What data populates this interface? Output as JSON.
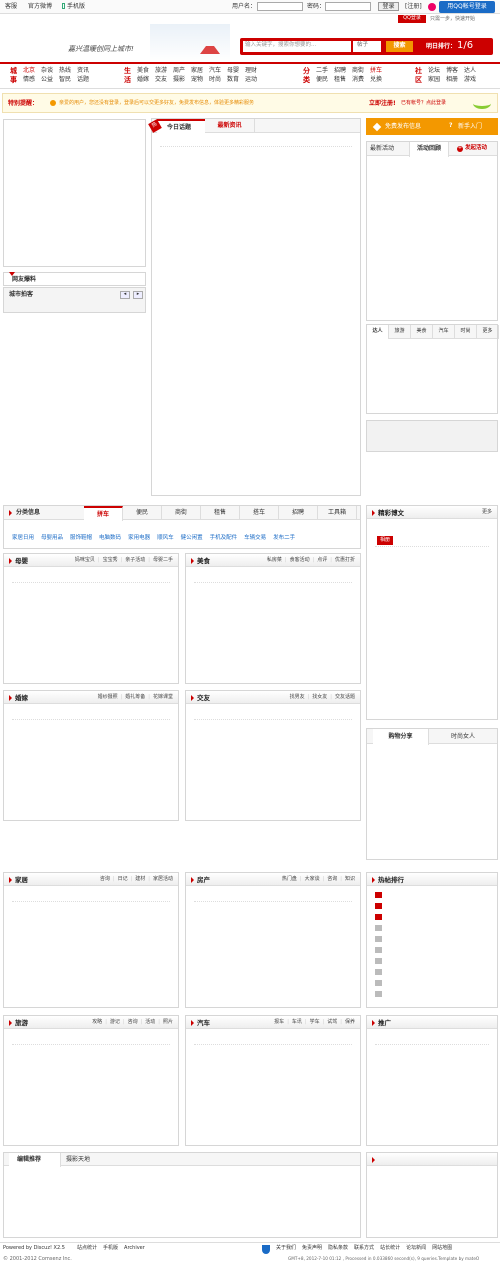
{
  "topbar": {
    "links": [
      "客服",
      "官方微博",
      "手机版"
    ],
    "username_label": "用户名：",
    "password_label": "密码：",
    "login_button": "登录",
    "register_link": "[注册]",
    "qq_login": "用QQ帐号登录",
    "qq_badge": "QQ登录",
    "qq_hint": "只需一步，快速开始"
  },
  "header": {
    "slogan": "嘉兴温暖创同上城市!",
    "search_placeholder": "输入关键字，搜索你想要的...",
    "search_type": "帖子",
    "search_button": "搜索",
    "countdown_label": "明日排行：",
    "countdown_value": "1/6"
  },
  "nav": {
    "groups": [
      {
        "title": [
          "城",
          "事"
        ],
        "rows": [
          [
            "北京",
            "杂谈",
            "热线",
            "资讯"
          ],
          [
            "情感",
            "公益",
            "智民",
            "话题"
          ]
        ],
        "red": [
          0
        ]
      },
      {
        "title": [
          "生",
          "活"
        ],
        "rows": [
          [
            "美食",
            "旅游",
            "周产",
            "家居",
            "汽车",
            "母婴",
            "理财"
          ],
          [
            "婚嫁",
            "交友",
            "摄影",
            "宠物",
            "时尚",
            "数育",
            "运动"
          ]
        ],
        "red": []
      },
      {
        "title": [
          "分",
          "类"
        ],
        "rows": [
          [
            "二手",
            "招聘",
            "商街",
            "拼车"
          ],
          [
            "便民",
            "租售",
            "消费",
            "兑换"
          ]
        ],
        "red": [
          3
        ]
      },
      {
        "title": [
          "社",
          "区"
        ],
        "rows": [
          [
            "论坛",
            "博客",
            "达人"
          ],
          [
            "家园",
            "相册",
            "游戏"
          ]
        ],
        "red": []
      }
    ]
  },
  "notice": {
    "label": "特别提醒：",
    "text": "亲爱的用户，您还没有登录，登录后可以交更多好友，免费发布信息，体验更多精彩服务",
    "sign": "立即注册!",
    "sign2": "已有帐号？点此登录"
  },
  "left": {
    "hot": "网友爆料",
    "city": "城市拍客"
  },
  "center": {
    "tabs": [
      "今日话题",
      "最新资讯"
    ],
    "badge": "热"
  },
  "right": {
    "publish": "免费发布信息",
    "newbie": "新手入门",
    "tabs": [
      "最新活动",
      "活动回顾",
      "发起活动"
    ],
    "people_tabs": [
      "达人",
      "旅游",
      "美食",
      "汽车",
      "时尚",
      "更多"
    ]
  },
  "classify": {
    "title": "分类信息",
    "tabs": [
      "拼车",
      "便民",
      "商街",
      "租售",
      "搭车",
      "招聘",
      "工具箱"
    ],
    "cats": [
      "家居日用",
      "母婴用品",
      "服饰鞋帽",
      "电脑数码",
      "家用电器",
      "顺风车",
      "健公闲置",
      "手机及配件",
      "车辆交易",
      "发布二手"
    ]
  },
  "jingcai": {
    "title": "精彩博文",
    "more": "更多",
    "tag": "相册"
  },
  "shop": {
    "tabs": [
      "购物分享",
      "时尚女人"
    ]
  },
  "panels": [
    {
      "title": "母婴",
      "links": [
        "妈咪宝贝",
        "宝宝秀",
        "亲子活动",
        "母婴二手"
      ]
    },
    {
      "title": "美食",
      "links": [
        "私房菜",
        "食客活动",
        "点评",
        "优惠打折"
      ]
    },
    {
      "title": "婚嫁",
      "links": [
        "婚纱摄照",
        "婚礼筹备",
        "花嫁课堂"
      ]
    },
    {
      "title": "交友",
      "links": [
        "找男友",
        "找女友",
        "交友话题"
      ]
    },
    {
      "title": "家居",
      "links": [
        "咨询",
        "日记",
        "建材",
        "家居活动"
      ]
    },
    {
      "title": "房产",
      "links": [
        "热门盘",
        "大家谈",
        "咨询",
        "知识"
      ]
    },
    {
      "title": "热帖排行",
      "links": []
    },
    {
      "title": "旅游",
      "links": [
        "攻略",
        "游记",
        "咨询",
        "活动",
        "照片"
      ]
    },
    {
      "title": "汽车",
      "links": [
        "报车",
        "车讯",
        "学车",
        "试驾",
        "保养"
      ]
    },
    {
      "title": "推广",
      "links": []
    }
  ],
  "bottom": {
    "tabs": [
      "编辑推荐",
      "摄影天地"
    ]
  },
  "footer": {
    "powered": "Powered by Discuz! X2.5",
    "links_left": [
      "站点统计",
      "手机版",
      "Archiver"
    ],
    "links_right": [
      "关于我们",
      "免责声明",
      "隐私条款",
      "联系方式",
      "站长统计",
      "论坛新闻",
      "网站地图"
    ],
    "copyright": "© 2001-2012 Comsenz Inc.",
    "gmt": "GMT+8, 2012-7-10 01:12 , Processed in 0.033860 second(s), 9 queries.Template by mateO"
  },
  "colors": {
    "accent": "#cc0000",
    "orange": "#f39800",
    "blue": "#1a6bc6"
  }
}
